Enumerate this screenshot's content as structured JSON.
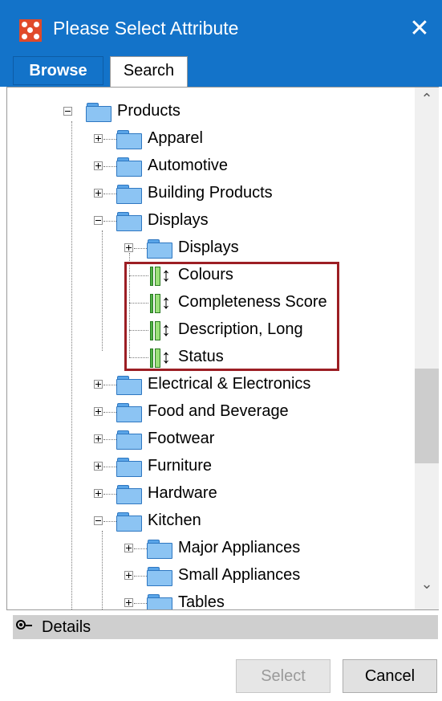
{
  "window": {
    "title": "Please Select Attribute",
    "close_glyph": "✕"
  },
  "tabs": [
    {
      "label": "Browse",
      "active": true
    },
    {
      "label": "Search",
      "active": false
    }
  ],
  "tree": {
    "items": [
      {
        "label": "Products",
        "type": "folder",
        "expander": "minus"
      },
      {
        "label": "Apparel",
        "type": "folder",
        "expander": "plus"
      },
      {
        "label": "Automotive",
        "type": "folder",
        "expander": "plus"
      },
      {
        "label": "Building Products",
        "type": "folder",
        "expander": "plus"
      },
      {
        "label": "Displays",
        "type": "folder",
        "expander": "minus"
      },
      {
        "label": "Displays",
        "type": "folder",
        "expander": "plus"
      },
      {
        "label": "Colours",
        "type": "attribute"
      },
      {
        "label": "Completeness Score",
        "type": "attribute"
      },
      {
        "label": "Description, Long",
        "type": "attribute"
      },
      {
        "label": "Status",
        "type": "attribute"
      },
      {
        "label": "Electrical & Electronics",
        "type": "folder",
        "expander": "plus"
      },
      {
        "label": "Food and Beverage",
        "type": "folder",
        "expander": "plus"
      },
      {
        "label": "Footwear",
        "type": "folder",
        "expander": "plus"
      },
      {
        "label": "Furniture",
        "type": "folder",
        "expander": "plus"
      },
      {
        "label": "Hardware",
        "type": "folder",
        "expander": "plus"
      },
      {
        "label": "Kitchen",
        "type": "folder",
        "expander": "minus"
      },
      {
        "label": "Major Appliances",
        "type": "folder",
        "expander": "plus"
      },
      {
        "label": "Small Appliances",
        "type": "folder",
        "expander": "plus"
      },
      {
        "label": "Tables",
        "type": "folder",
        "expander": "plus"
      }
    ]
  },
  "scrollbar": {
    "up_glyph": "⌃",
    "down_glyph": "⌄"
  },
  "details": {
    "label": "Details"
  },
  "buttons": {
    "select": "Select",
    "cancel": "Cancel"
  },
  "colors": {
    "title_bar": "#1373c9",
    "highlight_box": "#9c1e24"
  }
}
